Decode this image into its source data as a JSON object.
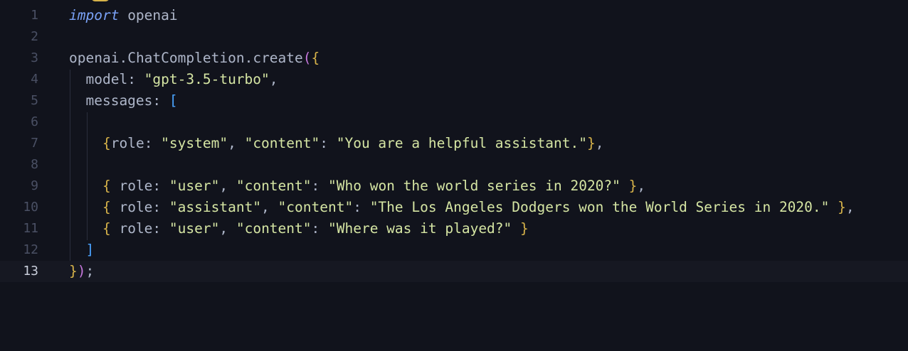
{
  "editor": {
    "colors": {
      "background": "#11131c",
      "current_line": "#161822",
      "line_number": "#4a5064",
      "text": "#aeb6c9",
      "keyword": "#7aa2f7",
      "string": "#d5e5a3",
      "bracket_gold": "#d7b34a",
      "bracket_magenta": "#c678dd",
      "bracket_blue": "#4aa3ff"
    },
    "current_line_number": 13,
    "lines": [
      {
        "n": "1",
        "tokens": [
          {
            "t": "import",
            "c": "kw"
          },
          {
            "t": " openai",
            "c": "id"
          }
        ]
      },
      {
        "n": "2",
        "tokens": []
      },
      {
        "n": "3",
        "tokens": [
          {
            "t": "openai",
            "c": "id"
          },
          {
            "t": ".",
            "c": "pun"
          },
          {
            "t": "ChatCompletion",
            "c": "id"
          },
          {
            "t": ".",
            "c": "pun"
          },
          {
            "t": "create",
            "c": "fn"
          },
          {
            "t": "(",
            "c": "b2"
          },
          {
            "t": "{",
            "c": "b1"
          }
        ]
      },
      {
        "n": "4",
        "tokens": [
          {
            "t": "  model",
            "c": "prop"
          },
          {
            "t": ": ",
            "c": "pun"
          },
          {
            "t": "\"gpt-3.5-turbo\"",
            "c": "str"
          },
          {
            "t": ",",
            "c": "pun"
          }
        ]
      },
      {
        "n": "5",
        "tokens": [
          {
            "t": "  messages",
            "c": "prop"
          },
          {
            "t": ": ",
            "c": "pun"
          },
          {
            "t": "[",
            "c": "b3"
          }
        ]
      },
      {
        "n": "6",
        "tokens": []
      },
      {
        "n": "7",
        "tokens": [
          {
            "t": "    ",
            "c": "pun"
          },
          {
            "t": "{",
            "c": "b1"
          },
          {
            "t": "role",
            "c": "prop"
          },
          {
            "t": ": ",
            "c": "pun"
          },
          {
            "t": "\"system\"",
            "c": "str"
          },
          {
            "t": ", ",
            "c": "pun"
          },
          {
            "t": "\"content\"",
            "c": "str"
          },
          {
            "t": ": ",
            "c": "pun"
          },
          {
            "t": "\"You are a helpful assistant.\"",
            "c": "str"
          },
          {
            "t": "}",
            "c": "b1"
          },
          {
            "t": ",",
            "c": "pun"
          }
        ]
      },
      {
        "n": "8",
        "tokens": []
      },
      {
        "n": "9",
        "tokens": [
          {
            "t": "    ",
            "c": "pun"
          },
          {
            "t": "{",
            "c": "b1"
          },
          {
            "t": " role",
            "c": "prop"
          },
          {
            "t": ": ",
            "c": "pun"
          },
          {
            "t": "\"user\"",
            "c": "str"
          },
          {
            "t": ", ",
            "c": "pun"
          },
          {
            "t": "\"content\"",
            "c": "str"
          },
          {
            "t": ": ",
            "c": "pun"
          },
          {
            "t": "\"Who won the world series in 2020?\"",
            "c": "str"
          },
          {
            "t": " ",
            "c": "pun"
          },
          {
            "t": "}",
            "c": "b1"
          },
          {
            "t": ",",
            "c": "pun"
          }
        ]
      },
      {
        "n": "10",
        "tokens": [
          {
            "t": "    ",
            "c": "pun"
          },
          {
            "t": "{",
            "c": "b1"
          },
          {
            "t": " role",
            "c": "prop"
          },
          {
            "t": ": ",
            "c": "pun"
          },
          {
            "t": "\"assistant\"",
            "c": "str"
          },
          {
            "t": ", ",
            "c": "pun"
          },
          {
            "t": "\"content\"",
            "c": "str"
          },
          {
            "t": ": ",
            "c": "pun"
          },
          {
            "t": "\"The Los Angeles Dodgers won the World Series in 2020.\"",
            "c": "str"
          },
          {
            "t": " ",
            "c": "pun"
          },
          {
            "t": "}",
            "c": "b1"
          },
          {
            "t": ",",
            "c": "pun"
          }
        ]
      },
      {
        "n": "11",
        "tokens": [
          {
            "t": "    ",
            "c": "pun"
          },
          {
            "t": "{",
            "c": "b1"
          },
          {
            "t": " role",
            "c": "prop"
          },
          {
            "t": ": ",
            "c": "pun"
          },
          {
            "t": "\"user\"",
            "c": "str"
          },
          {
            "t": ", ",
            "c": "pun"
          },
          {
            "t": "\"content\"",
            "c": "str"
          },
          {
            "t": ": ",
            "c": "pun"
          },
          {
            "t": "\"Where was it played?\"",
            "c": "str"
          },
          {
            "t": " ",
            "c": "pun"
          },
          {
            "t": "}",
            "c": "b1"
          }
        ]
      },
      {
        "n": "12",
        "tokens": [
          {
            "t": "  ",
            "c": "pun"
          },
          {
            "t": "]",
            "c": "b3"
          }
        ]
      },
      {
        "n": "13",
        "tokens": [
          {
            "t": "}",
            "c": "b1"
          },
          {
            "t": ")",
            "c": "b2"
          },
          {
            "t": ";",
            "c": "pun"
          }
        ]
      }
    ]
  }
}
